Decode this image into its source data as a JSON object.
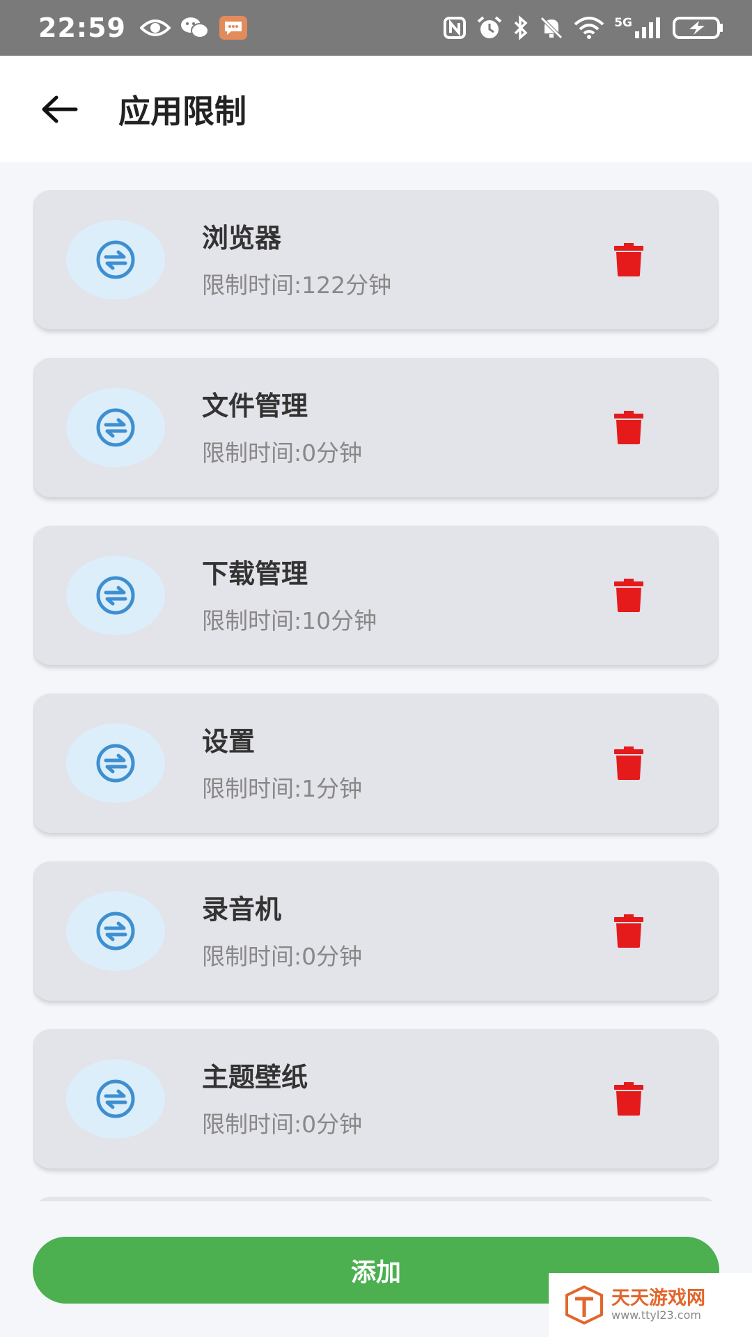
{
  "status_bar": {
    "time": "22:59",
    "network_label": "5G"
  },
  "header": {
    "title": "应用限制"
  },
  "apps": [
    {
      "name": "浏览器",
      "limit": "限制时间:122分钟"
    },
    {
      "name": "文件管理",
      "limit": "限制时间:0分钟"
    },
    {
      "name": "下载管理",
      "limit": "限制时间:10分钟"
    },
    {
      "name": "设置",
      "limit": "限制时间:1分钟"
    },
    {
      "name": "录音机",
      "limit": "限制时间:0分钟"
    },
    {
      "name": "主题壁纸",
      "limit": "限制时间:0分钟"
    }
  ],
  "add_button": {
    "label": "添加"
  },
  "watermark": {
    "title": "天天游戏网",
    "url": "www.ttyl23.com"
  },
  "colors": {
    "status_bar": "#7a7a7a",
    "accent_green": "#4caf50",
    "delete_red": "#e51b1b",
    "app_icon_blue": "#3d8fd1",
    "card_bg": "#e3e3ea"
  }
}
